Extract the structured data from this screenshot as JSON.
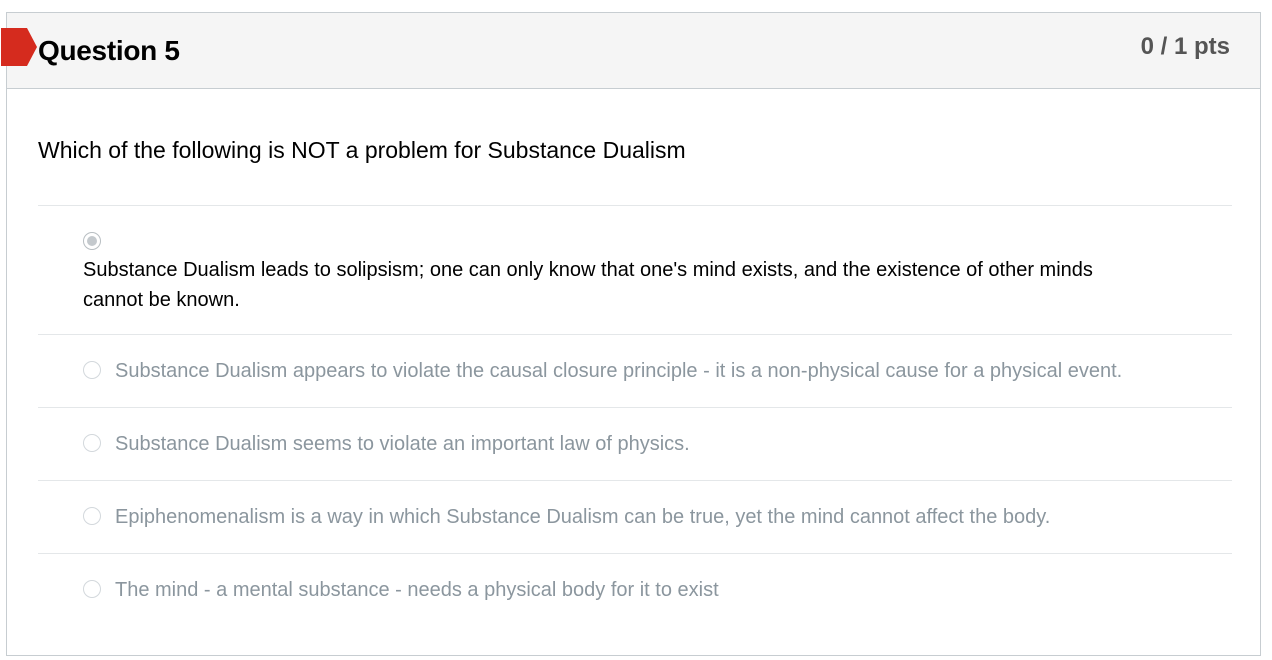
{
  "question": {
    "title": "Question 5",
    "points": "0 / 1 pts",
    "text": "Which of the following is NOT a problem for Substance Dualism",
    "status": "incorrect",
    "flag_color": "#d52b1e"
  },
  "answers": [
    {
      "text": "Substance Dualism leads to solipsism; one can only know that one's mind exists, and the existence of other minds cannot be known.",
      "selected": true
    },
    {
      "text": "Substance Dualism appears to violate the causal closure principle - it is a non-physical cause for a physical event.",
      "selected": false
    },
    {
      "text": "Substance Dualism seems to violate an important law of physics.",
      "selected": false
    },
    {
      "text": "Epiphenomenalism is a way in which Substance Dualism can be true, yet the mind cannot affect the body.",
      "selected": false
    },
    {
      "text": "The mind - a mental substance - needs a physical body for it to exist",
      "selected": false
    }
  ]
}
